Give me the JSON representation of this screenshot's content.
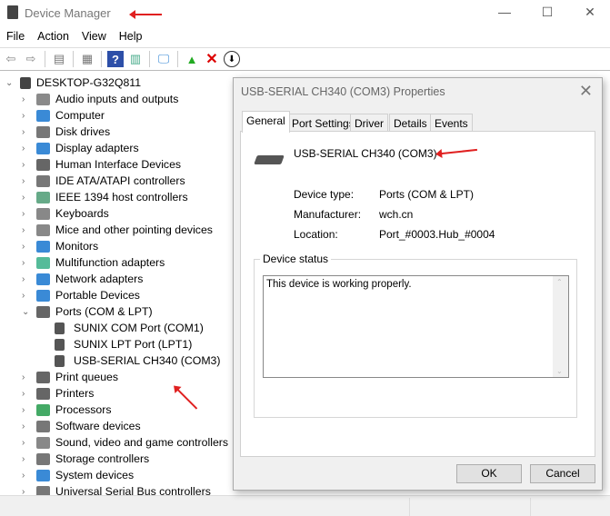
{
  "window": {
    "title": "Device Manager",
    "minimize": "—",
    "maximize": "☐",
    "close": "✕"
  },
  "menu": [
    "File",
    "Action",
    "View",
    "Help"
  ],
  "tree": {
    "root": "DESKTOP-G32Q811",
    "items": [
      {
        "label": "Audio inputs and outputs",
        "color": "#8a8a8a"
      },
      {
        "label": "Computer",
        "color": "#3a8ad6"
      },
      {
        "label": "Disk drives",
        "color": "#777"
      },
      {
        "label": "Display adapters",
        "color": "#3a8ad6"
      },
      {
        "label": "Human Interface Devices",
        "color": "#666"
      },
      {
        "label": "IDE ATA/ATAPI controllers",
        "color": "#777"
      },
      {
        "label": "IEEE 1394 host controllers",
        "color": "#6a8"
      },
      {
        "label": "Keyboards",
        "color": "#888"
      },
      {
        "label": "Mice and other pointing devices",
        "color": "#888"
      },
      {
        "label": "Monitors",
        "color": "#3a8ad6"
      },
      {
        "label": "Multifunction adapters",
        "color": "#5b9"
      },
      {
        "label": "Network adapters",
        "color": "#3a8ad6"
      },
      {
        "label": "Portable Devices",
        "color": "#3a8ad6"
      },
      {
        "label": "Ports (COM & LPT)",
        "color": "#666",
        "expanded": true,
        "children": [
          "SUNIX COM Port (COM1)",
          "SUNIX LPT Port (LPT1)",
          "USB-SERIAL CH340 (COM3)"
        ]
      },
      {
        "label": "Print queues",
        "color": "#666"
      },
      {
        "label": "Printers",
        "color": "#666"
      },
      {
        "label": "Processors",
        "color": "#4a6"
      },
      {
        "label": "Software devices",
        "color": "#777"
      },
      {
        "label": "Sound, video and game controllers",
        "color": "#888"
      },
      {
        "label": "Storage controllers",
        "color": "#777"
      },
      {
        "label": "System devices",
        "color": "#3a8ad6"
      },
      {
        "label": "Universal Serial Bus controllers",
        "color": "#777"
      }
    ]
  },
  "dialog": {
    "title": "USB-SERIAL CH340 (COM3) Properties",
    "close": "✕",
    "tabs": [
      "General",
      "Port Settings",
      "Driver",
      "Details",
      "Events"
    ],
    "device_name": "USB-SERIAL CH340 (COM3)",
    "fields": [
      {
        "label": "Device type:",
        "value": "Ports (COM & LPT)"
      },
      {
        "label": "Manufacturer:",
        "value": "wch.cn"
      },
      {
        "label": "Location:",
        "value": "Port_#0003.Hub_#0004"
      }
    ],
    "status_group": "Device status",
    "status_text": "This device is working properly.",
    "ok": "OK",
    "cancel": "Cancel"
  }
}
